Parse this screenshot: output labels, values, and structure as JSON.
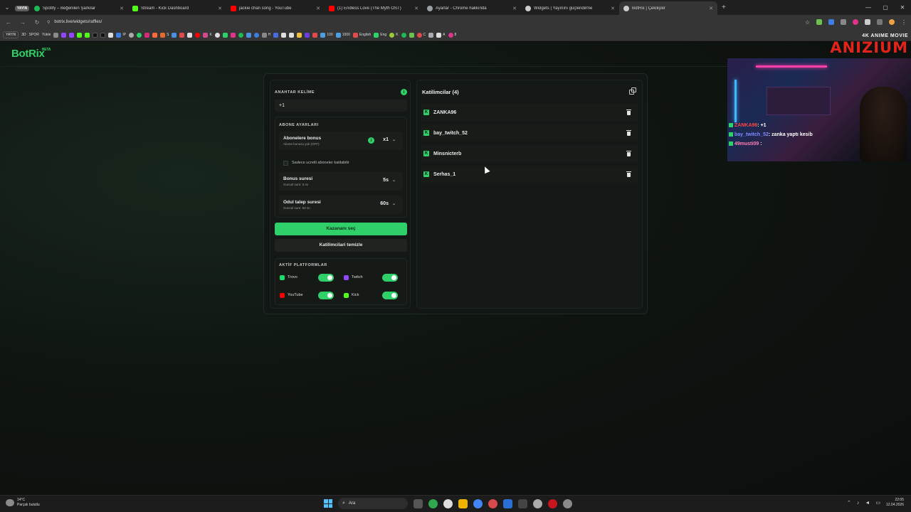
{
  "browser": {
    "tabs": [
      {
        "title": "Spotify – Beğenilen Şarkılar",
        "color": "#1db954"
      },
      {
        "title": "Stream - Kick Dashboard",
        "color": "#53fc18"
      },
      {
        "title": "jackie chan song - YouTube",
        "color": "#ff0000"
      },
      {
        "title": "(1) Endless Love (The Myth OST)",
        "color": "#ff0000"
      },
      {
        "title": "Ayarlar - Chrome hakkında",
        "color": "#9aa0a6"
      },
      {
        "title": "Widgets | Yayınını güçlendirme",
        "color": "#cccccc"
      },
      {
        "title": "BotRix | Çekilişler",
        "color": "#cccccc"
      }
    ],
    "group_label": "YAYIN",
    "url": "botrix.live/widgets/raffles/",
    "bookmarks": [
      "YAYIN",
      "3D",
      "SPOR",
      "Yükle",
      "S",
      "IP",
      "K",
      "H",
      "100",
      "1000",
      "English",
      "Eng",
      "K",
      "C",
      "A",
      "8"
    ]
  },
  "page": {
    "brand": "BotRix",
    "brand_badge": "BETA",
    "keyword": {
      "label": "ANAHTAR KELİME",
      "value": "+1",
      "info_icon": "i"
    },
    "subscriber": {
      "label": "ABONE AYARLARI",
      "bonus_title": "Abonelere bonus",
      "bonus_sub": "Abone bonusu yok (OFF)",
      "bonus_value": "x1",
      "only_paid": "Sadece ucretli aboneler katilabilir",
      "bonus_time_title": "Bonus suresi",
      "bonus_time_sub": "Guncel sure: 5 sn",
      "bonus_time_value": "5s",
      "claim_time_title": "Odul talep suresi",
      "claim_time_sub": "Guncel sure: 60 sn",
      "claim_time_value": "60s"
    },
    "buttons": {
      "pick_winner": "Kazananı seç",
      "clear_participants": "Katilimcilari temizle"
    },
    "platforms": {
      "label": "AKTİF PLATFORMLAR",
      "items": [
        {
          "name": "Trovo",
          "color": "#1bd96a",
          "enabled": true
        },
        {
          "name": "Twitch",
          "color": "#9146ff",
          "enabled": true
        },
        {
          "name": "YouTube",
          "color": "#ff0000",
          "enabled": true
        },
        {
          "name": "Kick",
          "color": "#53fc18",
          "enabled": true
        }
      ]
    },
    "participants": {
      "title": "Katilimcilar (4)",
      "list": [
        "ZANKA96",
        "bay_twitch_52",
        "Minsnicterb",
        "Serhas_1"
      ]
    }
  },
  "overlay": {
    "logo_sub": "4K ANIME MOVIE",
    "logo_main": "ANIZIUM",
    "chat": [
      {
        "user": "ZANKA96",
        "msg": ": +1"
      },
      {
        "user": "bay_twitch_52",
        "msg": ": zanka yaptı kesib"
      },
      {
        "user": "49musti09",
        "msg": " :"
      }
    ]
  },
  "taskbar": {
    "weather_temp": "14°C",
    "weather_desc": "Parçalı bulutlu",
    "search_placeholder": "Ara",
    "time": "22:05",
    "date": "12.04.2026"
  },
  "colors": {
    "accent": "#2fd06a",
    "background": "#0b0e0c"
  }
}
